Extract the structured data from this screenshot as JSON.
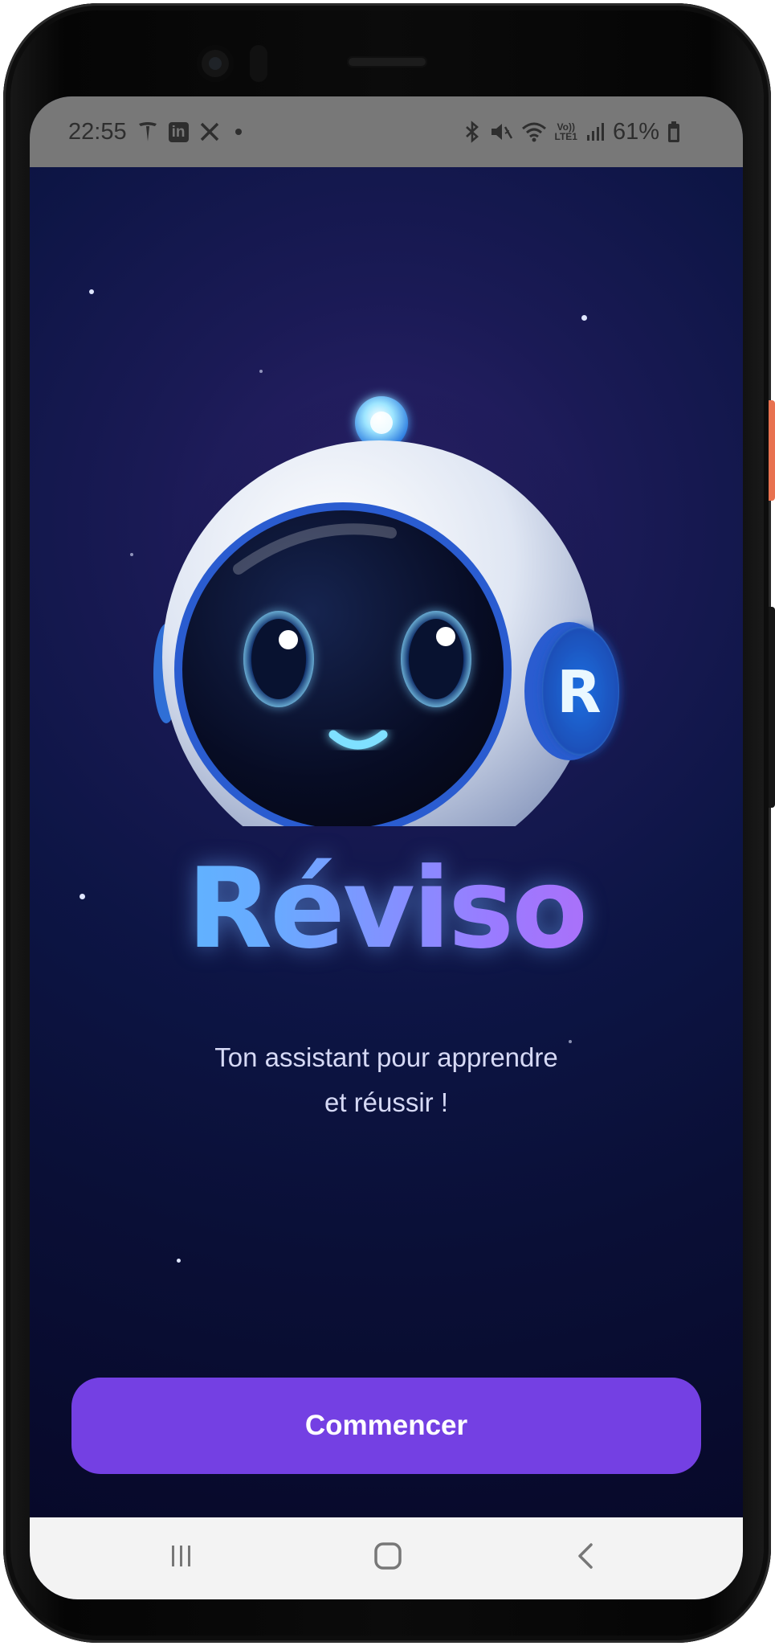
{
  "status_bar": {
    "time": "22:55",
    "notification_icons": [
      "tesla-icon",
      "linkedin-icon",
      "x-icon",
      "dot-icon"
    ],
    "linkedin_text": "in",
    "system_icons": [
      "bluetooth-icon",
      "vibrate-icon",
      "wifi-icon",
      "volte-icon",
      "signal-icon",
      "battery-icon"
    ],
    "volte_line1": "Vo))",
    "volte_line2": "LTE1",
    "battery": "61%"
  },
  "app": {
    "mascot_badge": "R",
    "brand_name": "Réviso",
    "tagline_line1": "Ton assistant pour apprendre",
    "tagline_line2": "et réussir !",
    "cta_label": "Commencer"
  },
  "nav_bar": {
    "items": [
      "recents-icon",
      "home-icon",
      "back-icon"
    ]
  },
  "colors": {
    "background": "#0a0f36",
    "cta": "#7440e3",
    "brand_gradient": [
      "#4fc2ff",
      "#9a7bff",
      "#c45ff0"
    ],
    "status_bar": "#787878",
    "nav_bar": "#f3f3f3"
  }
}
